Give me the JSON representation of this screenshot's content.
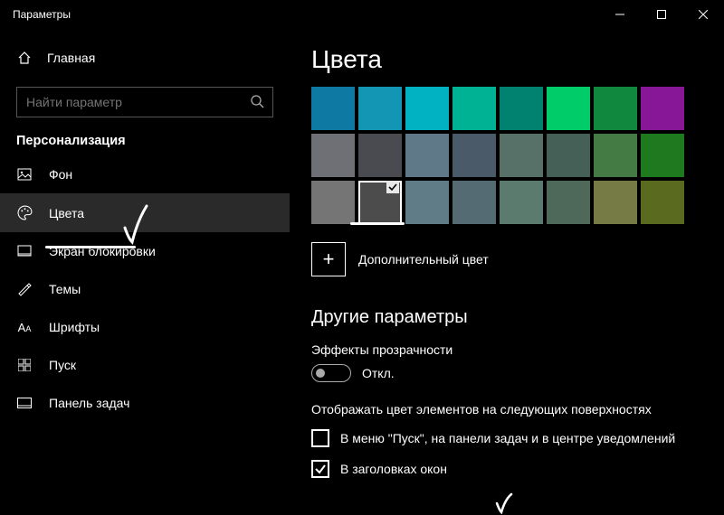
{
  "window": {
    "title": "Параметры"
  },
  "sidebar": {
    "home": "Главная",
    "search_placeholder": "Найти параметр",
    "section": "Персонализация",
    "items": [
      {
        "label": "Фон"
      },
      {
        "label": "Цвета"
      },
      {
        "label": "Экран блокировки"
      },
      {
        "label": "Темы"
      },
      {
        "label": "Шрифты"
      },
      {
        "label": "Пуск"
      },
      {
        "label": "Панель задач"
      }
    ]
  },
  "page": {
    "title": "Цвета",
    "custom_color_label": "Дополнительный цвет",
    "more_options": "Другие параметры",
    "transparency_label": "Эффекты прозрачности",
    "transparency_state": "Откл.",
    "surfaces_label": "Отображать цвет элементов на следующих поверхностях",
    "check1": "В меню \"Пуск\", на панели задач и в центре уведомлений",
    "check2": "В заголовках окон"
  },
  "colors": {
    "row1": [
      "#0e7aa3",
      "#1395b4",
      "#00b2c2",
      "#00b294",
      "#018170",
      "#00cc6a",
      "#10893e",
      "#881798"
    ],
    "row2": [
      "#6f6f76",
      "#4a4b50",
      "#607988",
      "#4b5a68",
      "#577169",
      "#456057",
      "#447a43",
      "#1f7a1f"
    ],
    "row3": [
      "#757575",
      "#4c4c4c",
      "#607c87",
      "#546b74",
      "#5c7b6f",
      "#4e6959",
      "#767b45",
      "#5a6b1f"
    ]
  }
}
